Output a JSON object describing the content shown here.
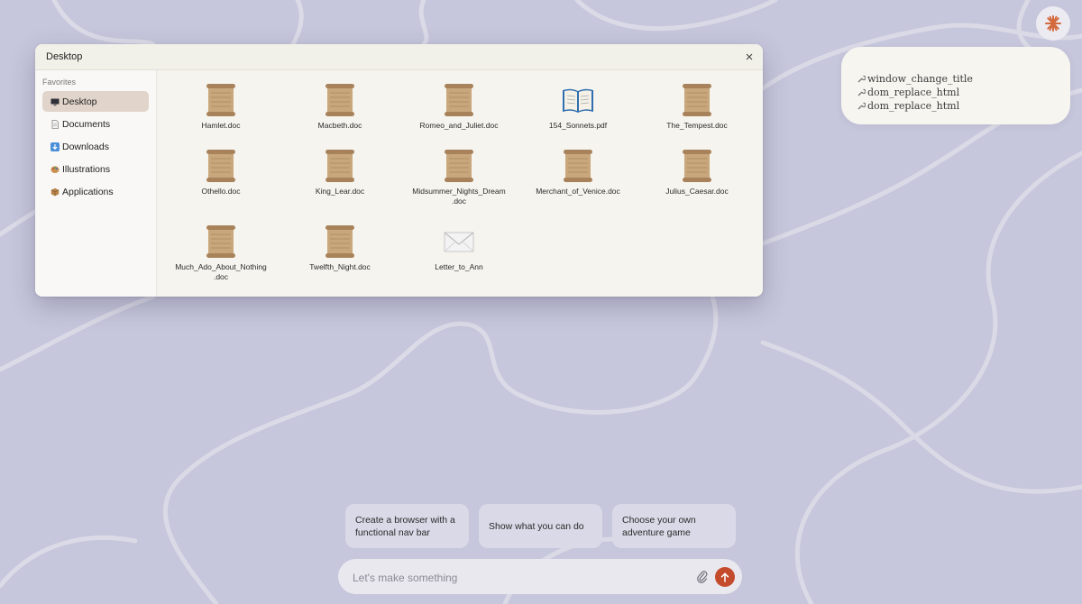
{
  "colors": {
    "background": "#c6c6dc",
    "accent": "#c44b2c",
    "window_bg": "#f6f4ee",
    "sidebar_active": "#e1d5cb"
  },
  "assistant": {
    "logo_icon": "sparkle-asterisk-icon"
  },
  "tool_calls": [
    {
      "icon": "wrench-icon",
      "label": "window_change_title"
    },
    {
      "icon": "wrench-icon",
      "label": "dom_replace_html"
    },
    {
      "icon": "wrench-icon",
      "label": "dom_replace_html"
    }
  ],
  "window": {
    "title": "Desktop",
    "sidebar": {
      "heading": "Favorites",
      "items": [
        {
          "icon": "monitor-icon",
          "label": "Desktop",
          "active": true
        },
        {
          "icon": "document-icon",
          "label": "Documents",
          "active": false
        },
        {
          "icon": "download-arrow-icon",
          "label": "Downloads",
          "active": false
        },
        {
          "icon": "palette-icon",
          "label": "Illustrations",
          "active": false
        },
        {
          "icon": "package-icon",
          "label": "Applications",
          "active": false
        }
      ]
    },
    "files": [
      {
        "name": "Hamlet.doc",
        "icon": "scroll-icon"
      },
      {
        "name": "Macbeth.doc",
        "icon": "scroll-icon"
      },
      {
        "name": "Romeo_and_Juliet.doc",
        "icon": "scroll-icon"
      },
      {
        "name": "154_Sonnets.pdf",
        "icon": "open-book-icon"
      },
      {
        "name": "The_Tempest.doc",
        "icon": "scroll-icon"
      },
      {
        "name": "Othello.doc",
        "icon": "scroll-icon"
      },
      {
        "name": "King_Lear.doc",
        "icon": "scroll-icon"
      },
      {
        "name": "Midsummer_Nights_Dream\n.doc",
        "icon": "scroll-icon"
      },
      {
        "name": "Merchant_of_Venice.doc",
        "icon": "scroll-icon"
      },
      {
        "name": "Julius_Caesar.doc",
        "icon": "scroll-icon"
      },
      {
        "name": "Much_Ado_About_Nothing\n.doc",
        "icon": "scroll-icon"
      },
      {
        "name": "Twelfth_Night.doc",
        "icon": "scroll-icon"
      },
      {
        "name": "Letter_to_Ann",
        "icon": "envelope-icon"
      }
    ]
  },
  "suggestions": [
    "Create a browser with a functional nav bar",
    "Show what you can do",
    "Choose your own adventure game"
  ],
  "prompt": {
    "placeholder": "Let's make something",
    "value": ""
  }
}
